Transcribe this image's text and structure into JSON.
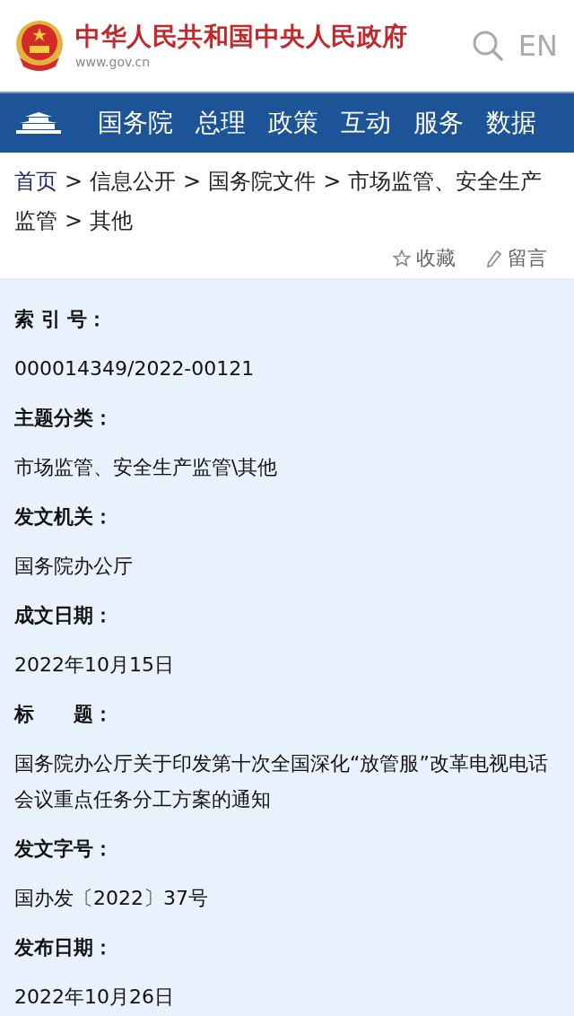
{
  "header": {
    "site_title": "中华人民共和国中央人民政府",
    "site_url": "www.gov.cn",
    "lang_button": "EN"
  },
  "nav": {
    "items": [
      {
        "label": "国务院"
      },
      {
        "label": "总理"
      },
      {
        "label": "政策"
      },
      {
        "label": "互动"
      },
      {
        "label": "服务"
      },
      {
        "label": "数据"
      }
    ]
  },
  "breadcrumb": {
    "items": [
      {
        "label": "首页",
        "kind": "link"
      },
      {
        "label": "信息公开",
        "kind": "text"
      },
      {
        "label": "国务院文件",
        "kind": "text"
      },
      {
        "label": "市场监管、安全生产监管",
        "kind": "text"
      },
      {
        "label": "其他",
        "kind": "text"
      }
    ],
    "separator": ">"
  },
  "actions": [
    {
      "label": "收藏",
      "kind": "favorite"
    },
    {
      "label": "留言",
      "kind": "comment"
    }
  ],
  "metadata": [
    {
      "label": "索 引 号：",
      "value": "000014349/2022-00121"
    },
    {
      "label": "主题分类：",
      "value": "市场监管、安全生产监管\\其他"
    },
    {
      "label": "发文机关：",
      "value": "国务院办公厅"
    },
    {
      "label": "成文日期：",
      "value": "2022年10月15日"
    },
    {
      "label": "标　　题：",
      "value": "国务院办公厅关于印发第十次全国深化“放管服”改革电视电话会议重点任务分工方案的通知"
    },
    {
      "label": "发文字号：",
      "value": "国办发〔2022〕37号"
    },
    {
      "label": "发布日期：",
      "value": "2022年10月26日"
    }
  ]
}
